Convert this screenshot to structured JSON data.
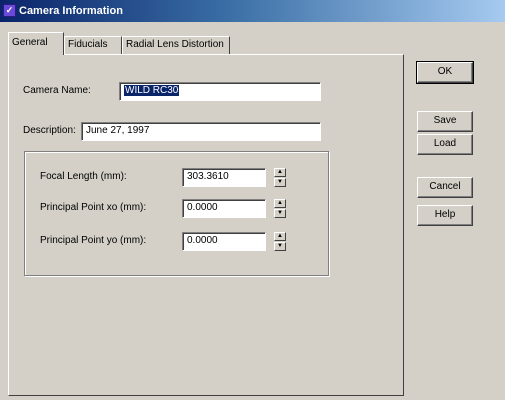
{
  "window": {
    "title": "Camera Information"
  },
  "tabs": [
    {
      "label": "General",
      "active": true
    },
    {
      "label": "Fiducials",
      "active": false
    },
    {
      "label": "Radial Lens Distortion",
      "active": false
    }
  ],
  "general": {
    "camera_name": {
      "label": "Camera Name:",
      "value": "WILD RC30"
    },
    "description": {
      "label": "Description:",
      "value": "June 27, 1997"
    },
    "focal_length": {
      "label": "Focal Length (mm):",
      "value": "303.3610"
    },
    "principal_point_xo": {
      "label": "Principal Point xo (mm):",
      "value": "0.0000"
    },
    "principal_point_yo": {
      "label": "Principal Point yo (mm):",
      "value": "0.0000"
    }
  },
  "buttons": {
    "ok": "OK",
    "save": "Save",
    "load": "Load",
    "cancel": "Cancel",
    "help": "Help"
  },
  "icons": {
    "spin_up": "▲",
    "spin_down": "▼"
  },
  "colors": {
    "titlebar_start": "#0a246a",
    "titlebar_end": "#a6caf0",
    "face": "#d4d0c8",
    "selection": "#0a246a"
  }
}
